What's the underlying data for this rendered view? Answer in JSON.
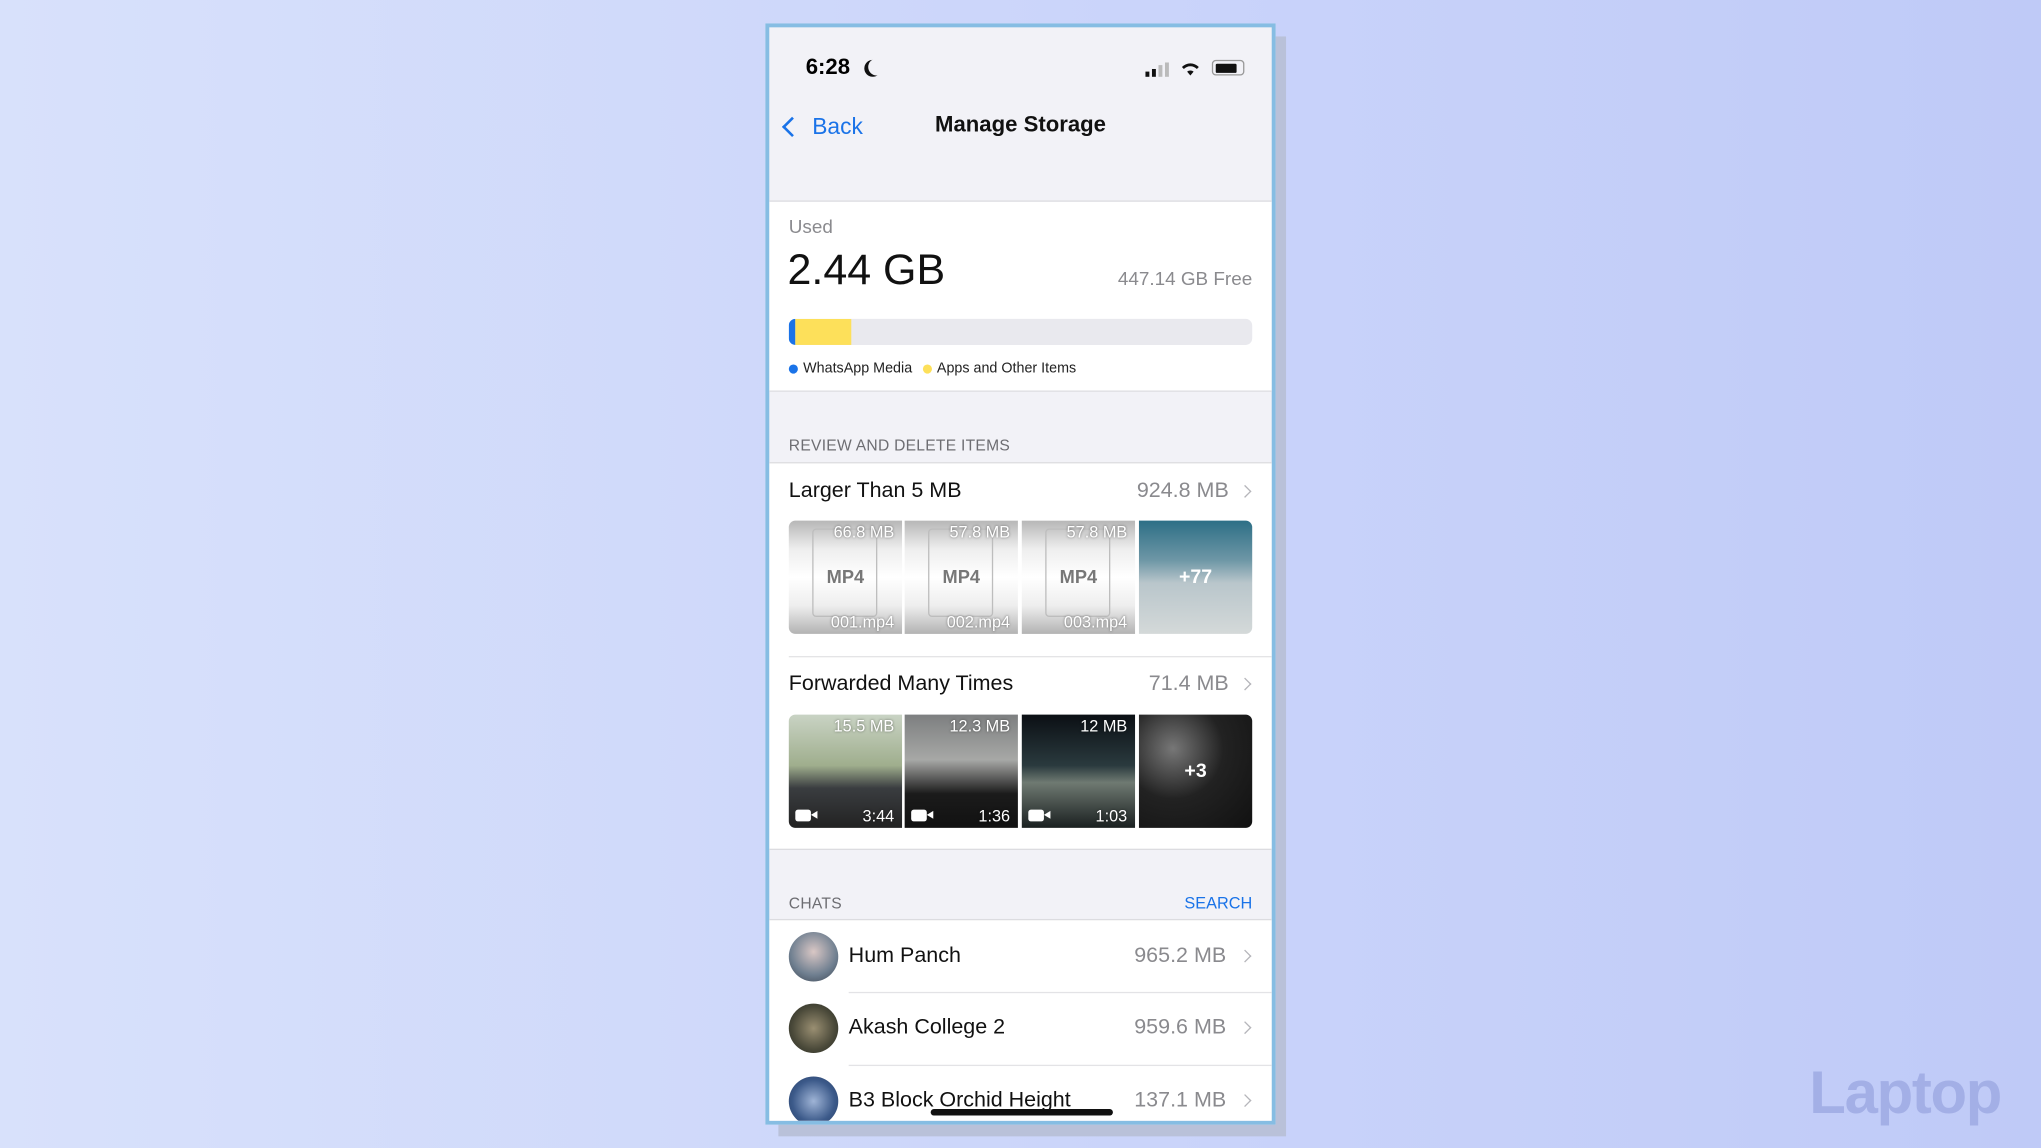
{
  "status": {
    "time": "6:28",
    "icons": [
      "moon-icon",
      "signal-icon",
      "wifi-icon",
      "battery-icon"
    ]
  },
  "nav": {
    "back_label": "Back",
    "title": "Manage Storage"
  },
  "storage": {
    "used_label": "Used",
    "used_value": "2.44 GB",
    "free_text": "447.14 GB Free",
    "bar": {
      "whatsapp_media_percent": 1.5,
      "apps_other_percent": 12
    },
    "legend": [
      {
        "label": "WhatsApp Media",
        "color": "#1a73e8"
      },
      {
        "label": "Apps and Other Items",
        "color": "#fde05a"
      }
    ]
  },
  "review": {
    "header": "REVIEW AND DELETE ITEMS",
    "larger": {
      "title": "Larger Than 5 MB",
      "size": "924.8 MB",
      "thumbs": [
        {
          "type": "MP4",
          "size": "66.8 MB",
          "name": "001.mp4"
        },
        {
          "type": "MP4",
          "size": "57.8 MB",
          "name": "002.mp4"
        },
        {
          "type": "MP4",
          "size": "57.8 MB",
          "name": "003.mp4"
        }
      ],
      "more": "+77"
    },
    "forwarded": {
      "title": "Forwarded Many Times",
      "size": "71.4 MB",
      "thumbs": [
        {
          "size": "15.5 MB",
          "duration": "3:44"
        },
        {
          "size": "12.3 MB",
          "duration": "1:36"
        },
        {
          "size": "12 MB",
          "duration": "1:03"
        }
      ],
      "more": "+3"
    }
  },
  "chats": {
    "header": "CHATS",
    "search_label": "SEARCH",
    "items": [
      {
        "name": "Hum Panch",
        "size": "965.2 MB"
      },
      {
        "name": "Akash College 2",
        "size": "959.6 MB"
      },
      {
        "name": "B3 Block Orchid Height",
        "size": "137.1 MB"
      }
    ]
  },
  "watermark": "Laptop",
  "colors": {
    "accent": "#1a73e8",
    "yellow": "#fde05a"
  }
}
